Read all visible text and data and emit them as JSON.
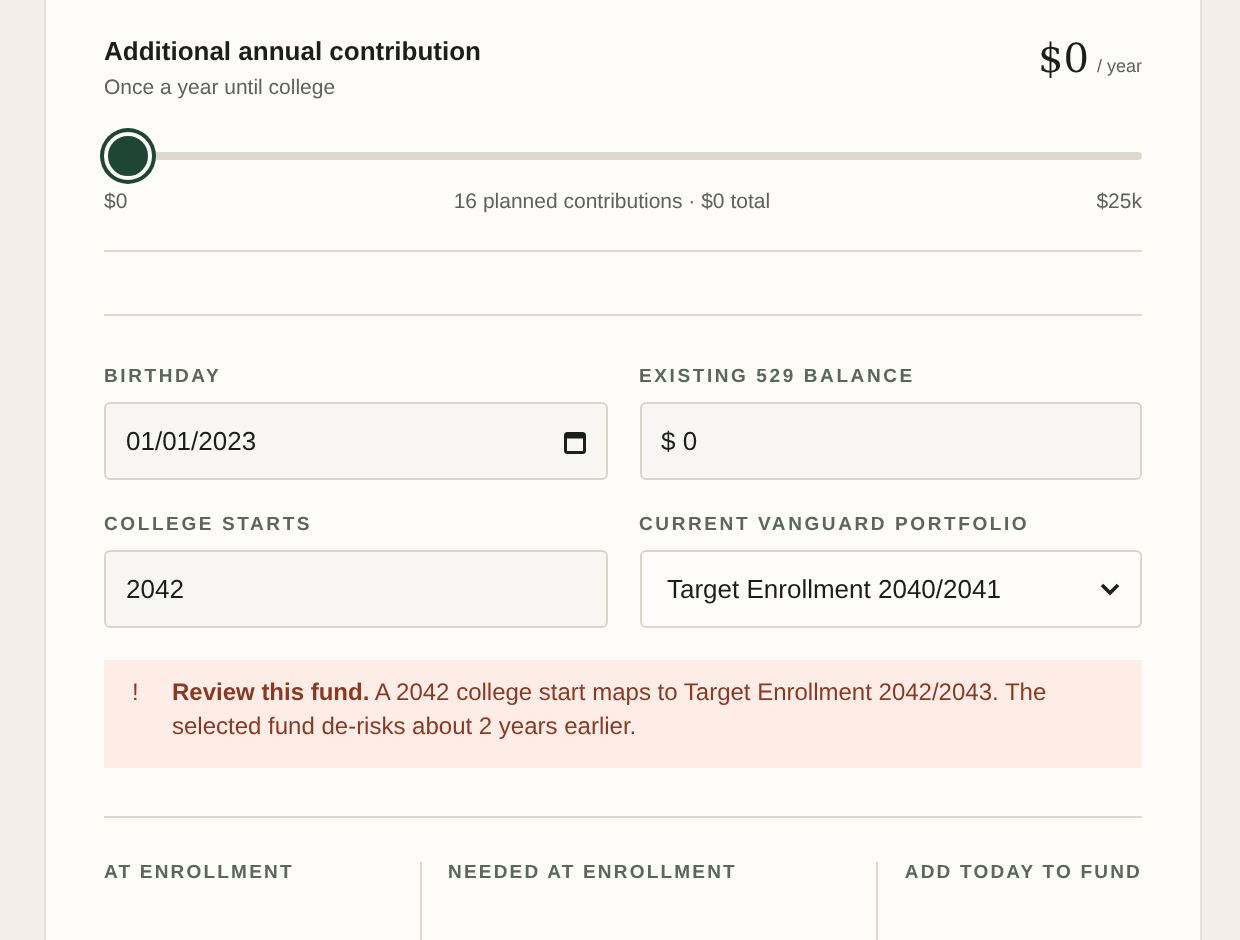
{
  "contribution": {
    "title": "Additional annual contribution",
    "subtitle": "Once a year until college",
    "amount": "$0",
    "unit": "/ year",
    "level": 0,
    "min_label": "$0",
    "summary": "16 planned contributions · $0 total",
    "max_label": "$25k"
  },
  "fields": [
    {
      "kind": "date",
      "label": "BIRTHDAY",
      "value": "01/01/2023"
    },
    {
      "kind": "currency",
      "label": "EXISTING 529 BALANCE",
      "prefix": "$",
      "value": "0"
    },
    {
      "kind": "text",
      "label": "COLLEGE STARTS",
      "value": "2042"
    },
    {
      "kind": "select",
      "label": "CURRENT VANGUARD PORTFOLIO",
      "value": "Target Enrollment 2040/2041"
    }
  ],
  "alert": {
    "icon": "!",
    "text": "**Review this fund.** A 2042 college start maps to Target Enrollment 2042/2043. The selected fund de-risks about 2 years earlier."
  },
  "stats": [
    {
      "label": "AT ENROLLMENT"
    },
    {
      "label": "NEEDED AT ENROLLMENT"
    },
    {
      "label": "ADD TODAY TO FUND"
    }
  ]
}
